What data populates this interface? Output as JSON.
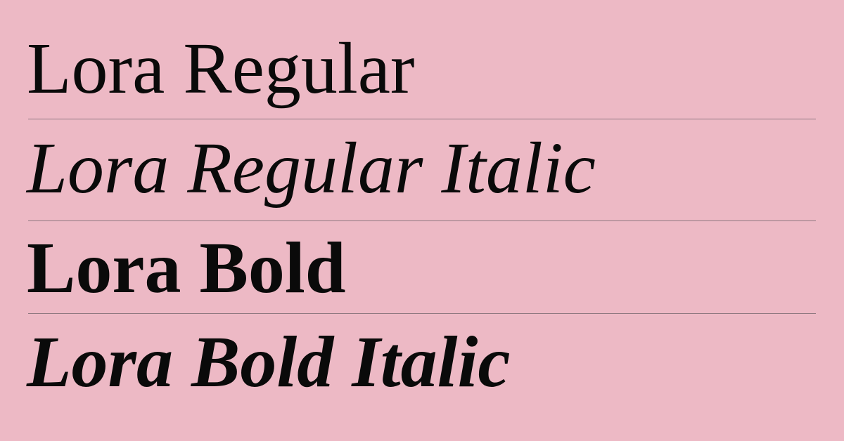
{
  "specimens": [
    {
      "label": "Lora Regular"
    },
    {
      "label": "Lora Regular Italic"
    },
    {
      "label": "Lora Bold"
    },
    {
      "label": "Lora Bold Italic"
    }
  ],
  "colors": {
    "background": "#edb9c5",
    "text": "#0a0a0a",
    "rule": "#8f7880"
  }
}
